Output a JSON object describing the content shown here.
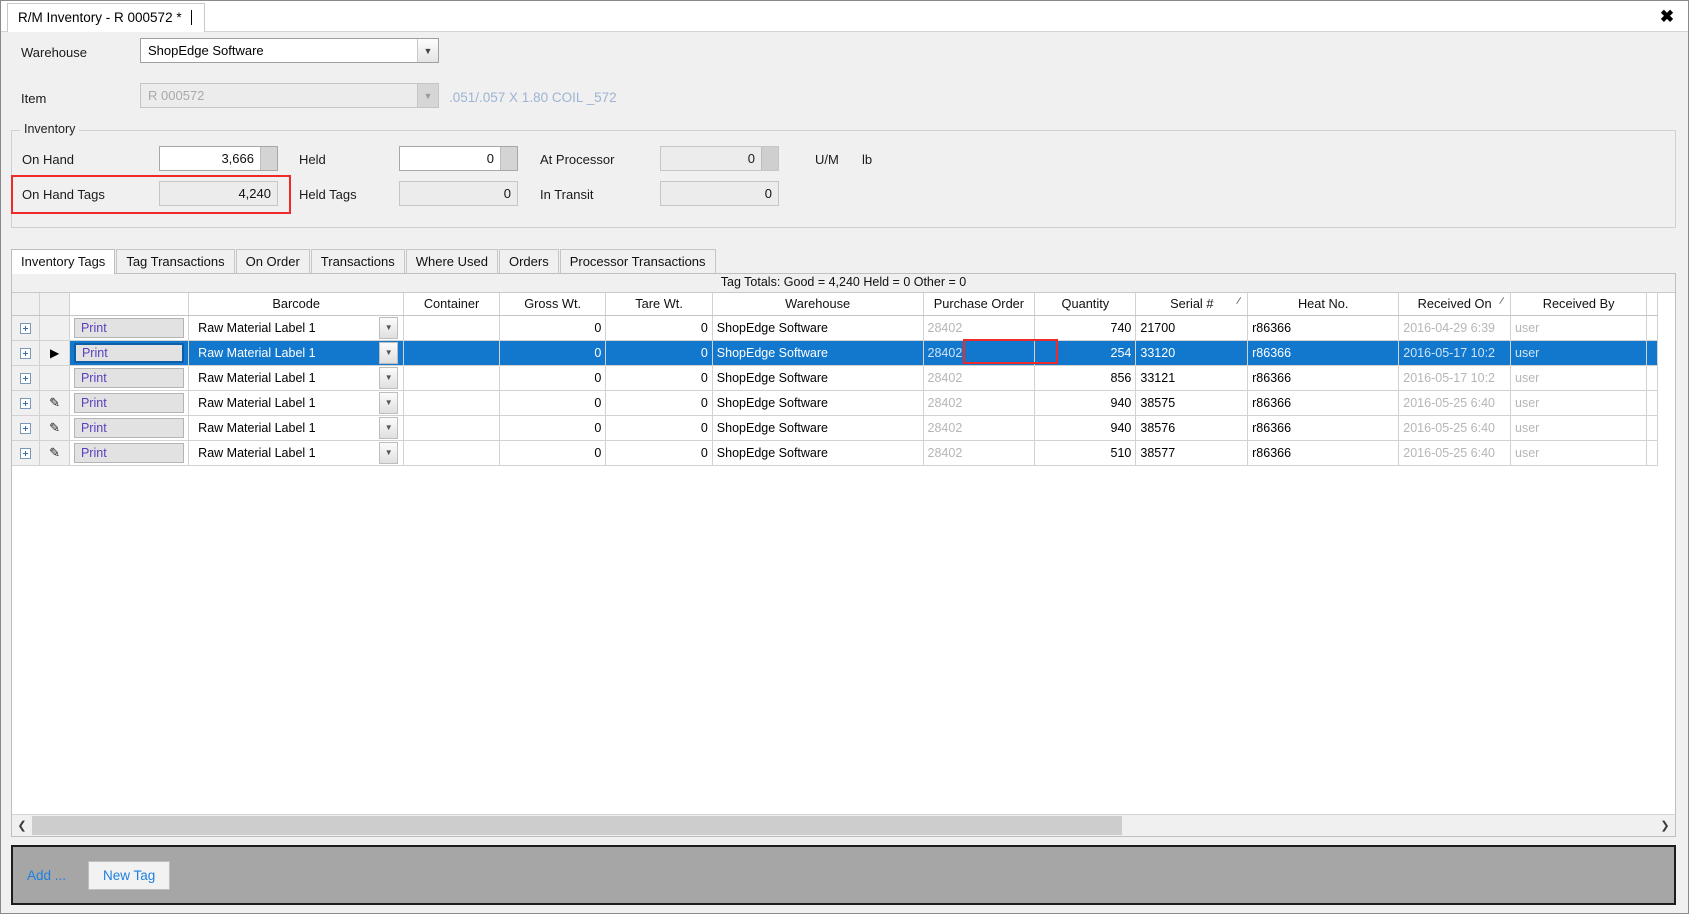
{
  "window": {
    "document_tab": "R/M Inventory - R 000572 *",
    "close_icon": "close-icon"
  },
  "form": {
    "warehouse_label": "Warehouse",
    "warehouse_value": "ShopEdge Software",
    "item_label": "Item",
    "item_value": "R 000572",
    "item_description": ".051/.057 X 1.80  COIL  _572"
  },
  "inventory": {
    "group_title": "Inventory",
    "on_hand_label": "On Hand",
    "on_hand_value": "3,666",
    "on_hand_tags_label": "On Hand Tags",
    "on_hand_tags_value": "4,240",
    "held_label": "Held",
    "held_value": "0",
    "held_tags_label": "Held Tags",
    "held_tags_value": "0",
    "at_processor_label": "At Processor",
    "at_processor_value": "0",
    "in_transit_label": "In Transit",
    "in_transit_value": "0",
    "um_label": "U/M",
    "um_value": "lb",
    "highlight_color": "#ef2a2a"
  },
  "tabs": [
    {
      "label": "Inventory Tags",
      "active": true
    },
    {
      "label": "Tag Transactions",
      "active": false
    },
    {
      "label": "On Order",
      "active": false
    },
    {
      "label": "Transactions",
      "active": false
    },
    {
      "label": "Where Used",
      "active": false
    },
    {
      "label": "Orders",
      "active": false
    },
    {
      "label": "Processor Transactions",
      "active": false
    }
  ],
  "grid": {
    "tag_totals": "Tag Totals:  Good = 4,240 Held = 0 Other = 0",
    "columns": [
      "Barcode",
      "Container",
      "Gross Wt.",
      "Tare Wt.",
      "Warehouse",
      "Purchase Order",
      "Quantity",
      "Serial #",
      "Heat No.",
      "Received On",
      "Received By"
    ],
    "sorted_columns": [
      "Serial #",
      "Received On"
    ],
    "print_label": "Print",
    "rows": [
      {
        "indicator": "",
        "print": "Print",
        "barcode": "Raw Material Label 1",
        "container": "",
        "gross_wt": "0",
        "tare_wt": "0",
        "warehouse": "ShopEdge Software",
        "purchase_order": "28402",
        "quantity": "740",
        "serial": "21700",
        "heat_no": "r86366",
        "received_on": "2016-04-29 6:39",
        "received_by": "user",
        "selected": false
      },
      {
        "indicator": "current-row-arrow",
        "print": "Print",
        "barcode": "Raw Material Label 1",
        "container": "",
        "gross_wt": "0",
        "tare_wt": "0",
        "warehouse": "ShopEdge Software",
        "purchase_order": "28402",
        "quantity": "254",
        "serial": "33120",
        "heat_no": "r86366",
        "received_on": "2016-05-17 10:2",
        "received_by": "user",
        "selected": true
      },
      {
        "indicator": "",
        "print": "Print",
        "barcode": "Raw Material Label 1",
        "container": "",
        "gross_wt": "0",
        "tare_wt": "0",
        "warehouse": "ShopEdge Software",
        "purchase_order": "28402",
        "quantity": "856",
        "serial": "33121",
        "heat_no": "r86366",
        "received_on": "2016-05-17 10:2",
        "received_by": "user",
        "selected": false
      },
      {
        "indicator": "pencil",
        "print": "Print",
        "barcode": "Raw Material Label 1",
        "container": "",
        "gross_wt": "0",
        "tare_wt": "0",
        "warehouse": "ShopEdge Software",
        "purchase_order": "28402",
        "quantity": "940",
        "serial": "38575",
        "heat_no": "r86366",
        "received_on": "2016-05-25 6:40",
        "received_by": "user",
        "selected": false
      },
      {
        "indicator": "pencil",
        "print": "Print",
        "barcode": "Raw Material Label 1",
        "container": "",
        "gross_wt": "0",
        "tare_wt": "0",
        "warehouse": "ShopEdge Software",
        "purchase_order": "28402",
        "quantity": "940",
        "serial": "38576",
        "heat_no": "r86366",
        "received_on": "2016-05-25 6:40",
        "received_by": "user",
        "selected": false
      },
      {
        "indicator": "pencil",
        "print": "Print",
        "barcode": "Raw Material Label 1",
        "container": "",
        "gross_wt": "0",
        "tare_wt": "0",
        "warehouse": "ShopEdge Software",
        "purchase_order": "28402",
        "quantity": "510",
        "serial": "38577",
        "heat_no": "r86366",
        "received_on": "2016-05-25 6:40",
        "received_by": "user",
        "selected": false
      }
    ]
  },
  "footer": {
    "add_label": "Add ...",
    "new_tag_label": "New Tag"
  }
}
